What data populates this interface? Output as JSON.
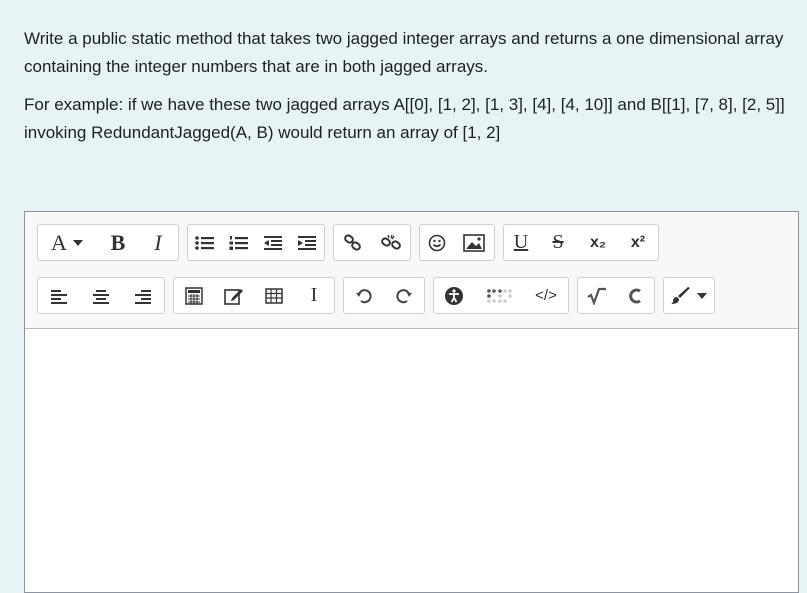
{
  "question": {
    "paragraph1": "Write a public static method that takes two jagged integer arrays and returns a one dimensional array containing the integer numbers that are in both jagged arrays.",
    "paragraph2": "For example: if we have these two jagged arrays A[[0], [1, 2], [1, 3], [4], [4, 10]] and B[[1], [7, 8], [2, 5]] invoking RedundantJagged(A, B) would return an array of [1, 2]"
  },
  "toolbar": {
    "font_size_label": "A",
    "bold_label": "B",
    "italic_label": "I",
    "underline_label": "U",
    "strikethrough_label": "S",
    "subscript_label": "x₂",
    "superscript_label": "x²",
    "html_label": "</>",
    "cursor_label": "I"
  },
  "editor": {
    "content": ""
  }
}
